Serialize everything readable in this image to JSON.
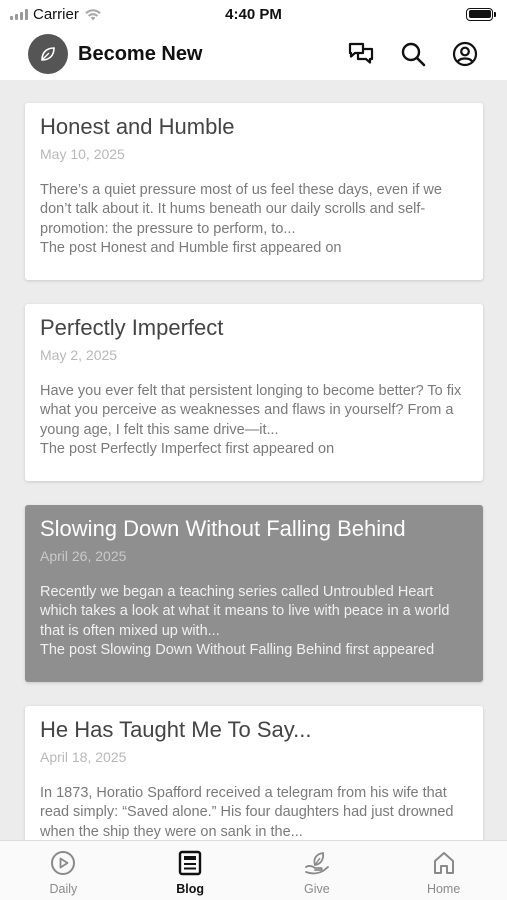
{
  "status_bar": {
    "carrier": "Carrier",
    "time": "4:40 PM"
  },
  "header": {
    "title": "Become New",
    "icons": [
      "chat-icon",
      "search-icon",
      "account-icon"
    ]
  },
  "posts": [
    {
      "title": "Honest and Humble",
      "date": "May 10, 2025",
      "excerpt": "There’s a quiet pressure most of us feel these days, even if we don’t talk about it. It hums beneath our daily scrolls and self-promotion: the pressure to perform, to...",
      "footer": "The post Honest and Humble first appeared on"
    },
    {
      "title": "Perfectly Imperfect",
      "date": "May 2, 2025",
      "excerpt": "Have you ever felt that persistent longing to become better? To fix what you perceive as weaknesses and flaws in yourself? From a young age, I felt this same drive—it...",
      "footer": "The post Perfectly Imperfect first appeared on"
    },
    {
      "title": "Slowing Down Without Falling Behind",
      "date": "April 26, 2025",
      "excerpt": "Recently we began a teaching series called Untroubled Heart which takes a look at what it means to live with peace in a world that is often mixed up with...",
      "footer": "The post Slowing Down Without Falling Behind first appeared"
    },
    {
      "title": "He Has Taught Me To Say...",
      "date": "April 18, 2025",
      "excerpt": "In 1873, Horatio Spafford received a telegram from his wife that read simply: “Saved alone.” His four daughters had just drowned when the ship they were on sank in the...",
      "footer": ""
    }
  ],
  "tabs": [
    {
      "label": "Daily",
      "icon": "play-circle-icon"
    },
    {
      "label": "Blog",
      "icon": "newspaper-icon"
    },
    {
      "label": "Give",
      "icon": "hand-leaf-icon"
    },
    {
      "label": "Home",
      "icon": "home-icon"
    }
  ],
  "colors": {
    "highlight_card": "#8f8f8f",
    "background": "#ececec",
    "active_tab": "#111111"
  }
}
